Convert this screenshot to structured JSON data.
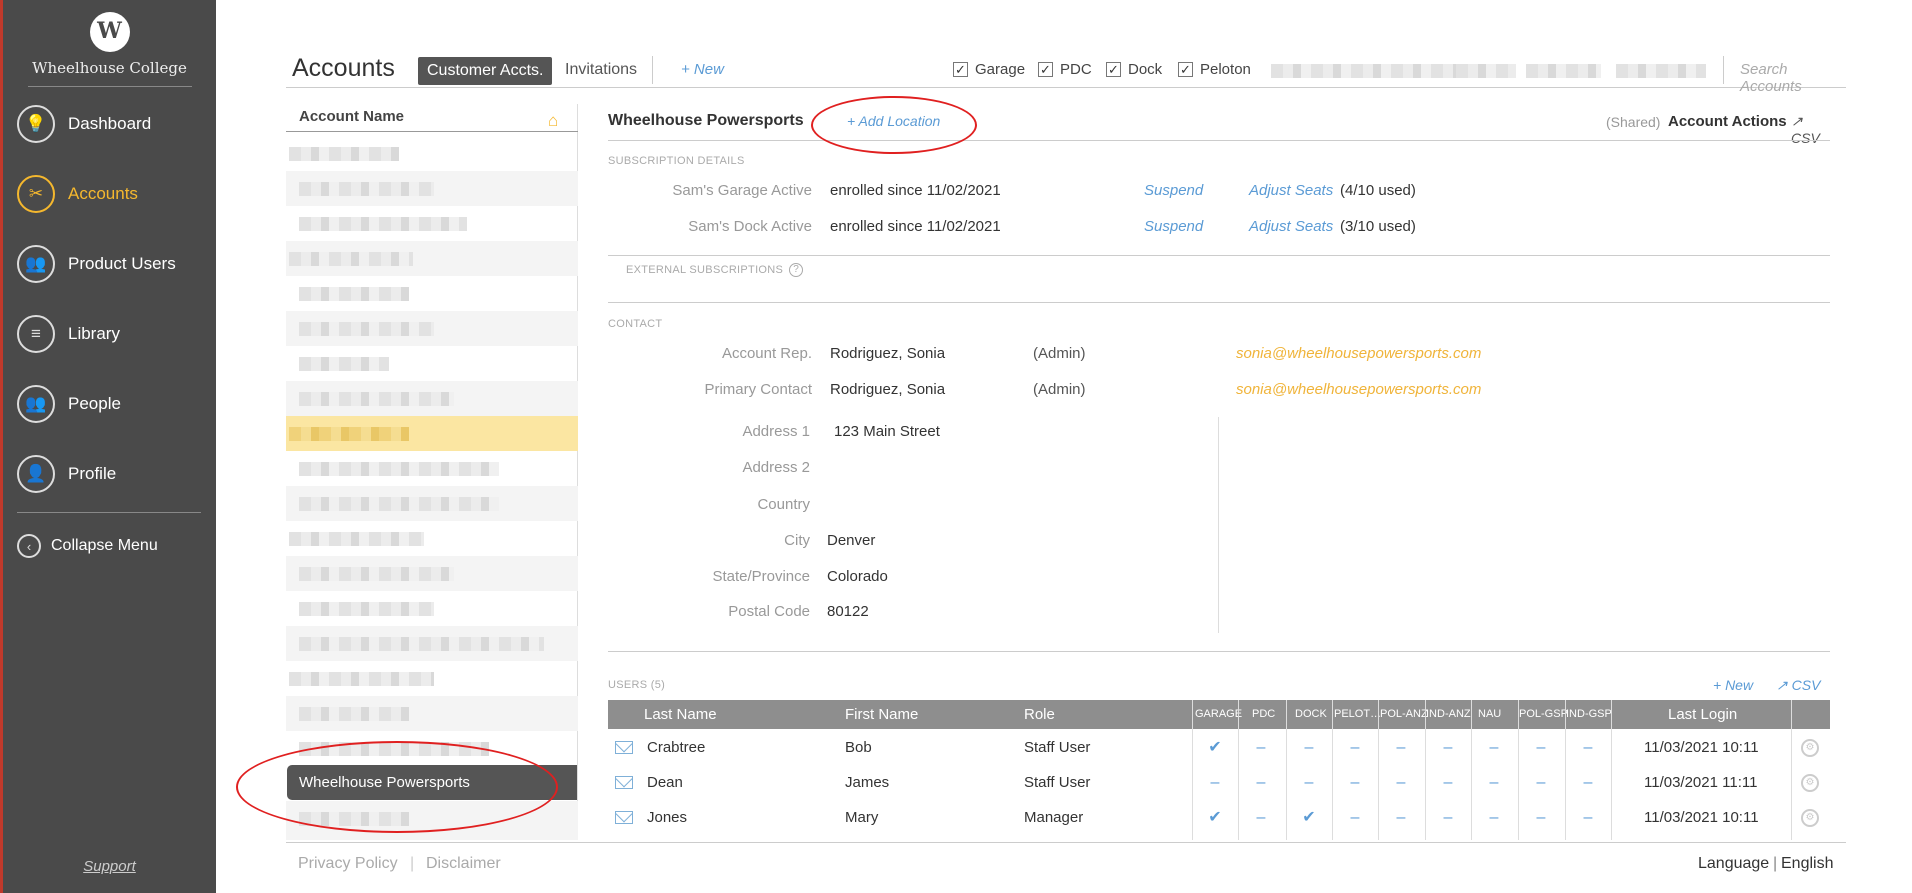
{
  "sidebar": {
    "brand": "Wheelhouse College",
    "logo_letter": "W",
    "items": [
      {
        "label": "Dashboard",
        "icon": "lightbulb-icon",
        "glyph": "💡"
      },
      {
        "label": "Accounts",
        "icon": "tools-icon",
        "glyph": "✂"
      },
      {
        "label": "Product Users",
        "icon": "users-icon",
        "glyph": "👥"
      },
      {
        "label": "Library",
        "icon": "books-icon",
        "glyph": "≡"
      },
      {
        "label": "People",
        "icon": "people-icon",
        "glyph": "👥"
      },
      {
        "label": "Profile",
        "icon": "profile-icon",
        "glyph": "👤"
      }
    ],
    "active": "Accounts",
    "collapse_label": "Collapse Menu",
    "collapse_glyph": "‹",
    "support": "Support"
  },
  "topbar": {
    "title": "Accounts",
    "tab_active": "Customer Accts.",
    "tab_invitations": "Invitations",
    "new_label": "+ New",
    "filters": [
      "Garage",
      "PDC",
      "Dock",
      "Peloton"
    ],
    "check_glyph": "✓",
    "search_placeholder": "Search Accounts"
  },
  "account_list": {
    "header": "Account Name",
    "home_glyph": "⌂",
    "selected": "Wheelhouse Powersports"
  },
  "detail": {
    "title": "Wheelhouse Powersports",
    "add_location": "+ Add Location",
    "shared": "(Shared)",
    "account_actions": "Account Actions",
    "csv": "CSV",
    "ext_glyph": "↗",
    "subscription_label": "SUBSCRIPTION DETAILS",
    "subscriptions": [
      {
        "label": "Sam's Garage Active",
        "status": "enrolled since 11/02/2021",
        "suspend": "Suspend",
        "adjust": "Adjust Seats",
        "seats": "(4/10 used)"
      },
      {
        "label": "Sam's Dock Active",
        "status": "enrolled since 11/02/2021",
        "suspend": "Suspend",
        "adjust": "Adjust Seats",
        "seats": "(3/10 used)"
      }
    ],
    "external_label": "EXTERNAL SUBSCRIPTIONS",
    "help_glyph": "?",
    "contact_label": "CONTACT",
    "contacts": [
      {
        "label": "Account Rep.",
        "name": "Rodriguez, Sonia",
        "role": "(Admin)",
        "email": "sonia@wheelhousepowersports.com"
      },
      {
        "label": "Primary Contact",
        "name": "Rodriguez, Sonia",
        "role": "(Admin)",
        "email": "sonia@wheelhousepowersports.com"
      }
    ],
    "address": [
      {
        "label": "Address 1",
        "value": "123 Main Street"
      },
      {
        "label": "Address 2",
        "value": ""
      },
      {
        "label": "Country",
        "value": ""
      },
      {
        "label": "City",
        "value": "Denver"
      },
      {
        "label": "State/Province",
        "value": "Colorado"
      },
      {
        "label": "Postal Code",
        "value": "80122"
      }
    ]
  },
  "users": {
    "label": "USERS (5)",
    "new_label": "+ New",
    "csv": "CSV",
    "columns": [
      "Last Name",
      "First Name",
      "Role",
      "GARAGE",
      "PDC",
      "DOCK",
      "PELOT…",
      "POL-ANZ",
      "IND-ANZ",
      "NAU",
      "POL-GSP",
      "IND-GSP",
      "Last Login"
    ],
    "rows": [
      {
        "last": "Crabtree",
        "first": "Bob",
        "role": "Staff User",
        "subs": [
          "✔",
          "–",
          "–",
          "–",
          "–",
          "–",
          "–",
          "–",
          "–"
        ],
        "login": "11/03/2021 10:11"
      },
      {
        "last": "Dean",
        "first": "James",
        "role": "Staff User",
        "subs": [
          "–",
          "–",
          "–",
          "–",
          "–",
          "–",
          "–",
          "–",
          "–"
        ],
        "login": "11/03/2021 11:11"
      },
      {
        "last": "Jones",
        "first": "Mary",
        "role": "Manager",
        "subs": [
          "✔",
          "–",
          "✔",
          "–",
          "–",
          "–",
          "–",
          "–",
          "–"
        ],
        "login": "11/03/2021 10:11"
      }
    ],
    "gear_glyph": "⚙"
  },
  "footer": {
    "privacy": "Privacy Policy",
    "sep": "|",
    "disclaimer": "Disclaimer",
    "language_label": "Language",
    "language_value": "English"
  },
  "colors": {
    "sidebar_bg": "#4a4a4a",
    "accent": "#f5b82e",
    "link": "#5b9bd5",
    "email": "#f0b43a",
    "annotation": "#e02020"
  }
}
